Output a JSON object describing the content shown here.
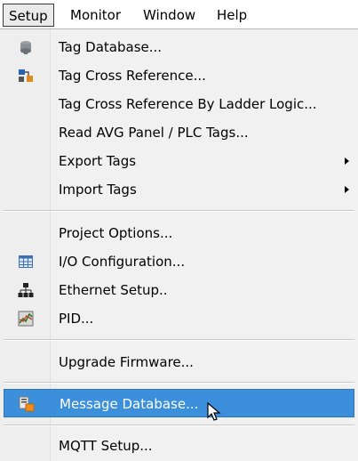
{
  "menubar": {
    "items": [
      "Setup",
      "Monitor",
      "Window",
      "Help"
    ]
  },
  "menu": {
    "items": [
      {
        "label": "Tag Database...",
        "icon": "tag-database-icon"
      },
      {
        "label": "Tag Cross Reference...",
        "icon": "cross-reference-icon"
      },
      {
        "label": "Tag Cross Reference By Ladder Logic..."
      },
      {
        "label": "Read AVG Panel / PLC Tags..."
      },
      {
        "label": "Export Tags",
        "submenu": true
      },
      {
        "label": "Import Tags",
        "submenu": true
      },
      {
        "label": "Project Options..."
      },
      {
        "label": "I/O Configuration...",
        "icon": "io-configuration-icon"
      },
      {
        "label": "Ethernet Setup..",
        "icon": "network-icon"
      },
      {
        "label": "PID...",
        "icon": "pid-icon"
      },
      {
        "label": "Upgrade Firmware..."
      },
      {
        "label": "Message Database...",
        "icon": "message-database-icon",
        "highlighted": true
      },
      {
        "label": "MQTT Setup..."
      }
    ]
  },
  "colors": {
    "highlight": "#3c8fdb",
    "menu_bg": "#f1f1f1"
  }
}
